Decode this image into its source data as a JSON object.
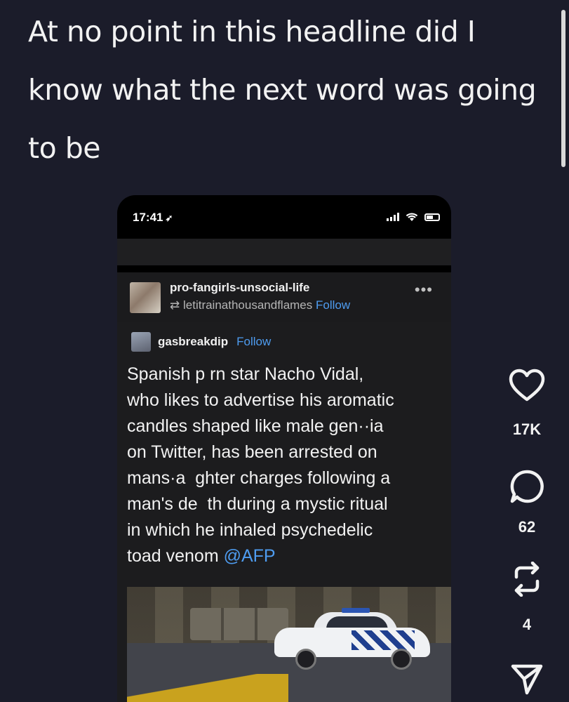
{
  "headline": "At no point in this headline did I know what the next word was going to be",
  "phone": {
    "time": "17:41",
    "location_icon": "location-arrow-icon"
  },
  "post": {
    "username": "pro-fangirls-unsocial-life",
    "reblogged_from": "letitrainathousandflames",
    "follow_label": "Follow",
    "menu_icon": "more-dots-icon",
    "original_poster": "gasbreakdip",
    "op_follow_label": "Follow",
    "text": "Spanish p rn star Nacho Vidal,\nwho likes to advertise his aromatic\ncandles shaped like male gen··ia\non Twitter, has been arrested on\nmans·a  ghter charges following a\nman's de  th during a mystic ritual\nin which he inhaled psychedelic\ntoad venom",
    "mention": "@AFP"
  },
  "actions": {
    "likes": "17K",
    "comments": "62",
    "reposts": "4"
  },
  "colors": {
    "background": "#1b1c2a",
    "link": "#4e9cf0"
  }
}
